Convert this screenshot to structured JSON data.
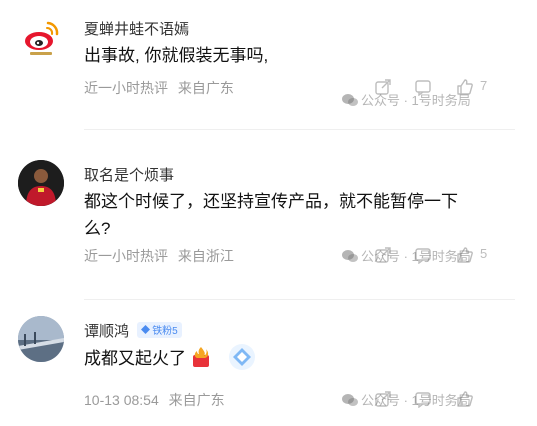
{
  "comments": [
    {
      "username": "夏蝉井蛙不语嫣",
      "text": "出事故, 你就假装无事吗,",
      "time": "近一小时热评",
      "location": "来自广东",
      "likes": "7",
      "watermark": "公众号 · 1号时务局"
    },
    {
      "username": "取名是个烦事",
      "text": "都这个时候了，还坚持宣传产品，就不能暂停一下么?",
      "time": "近一小时热评",
      "location": "来自浙江",
      "likes": "5",
      "watermark": "公众号 · 1号时务局"
    },
    {
      "username": "谭顺鸿",
      "badge": "铁粉5",
      "text": "成都又起火了",
      "time": "10-13 08:54",
      "location": "来自广东",
      "likes": "",
      "watermark": "公众号 · 1号时务局"
    }
  ],
  "colors": {
    "text": "#111111",
    "meta": "#9a9a9a",
    "weibo_red": "#e6162d",
    "badge_bg": "#e8f1ff",
    "badge_fg": "#4a8bf0"
  }
}
